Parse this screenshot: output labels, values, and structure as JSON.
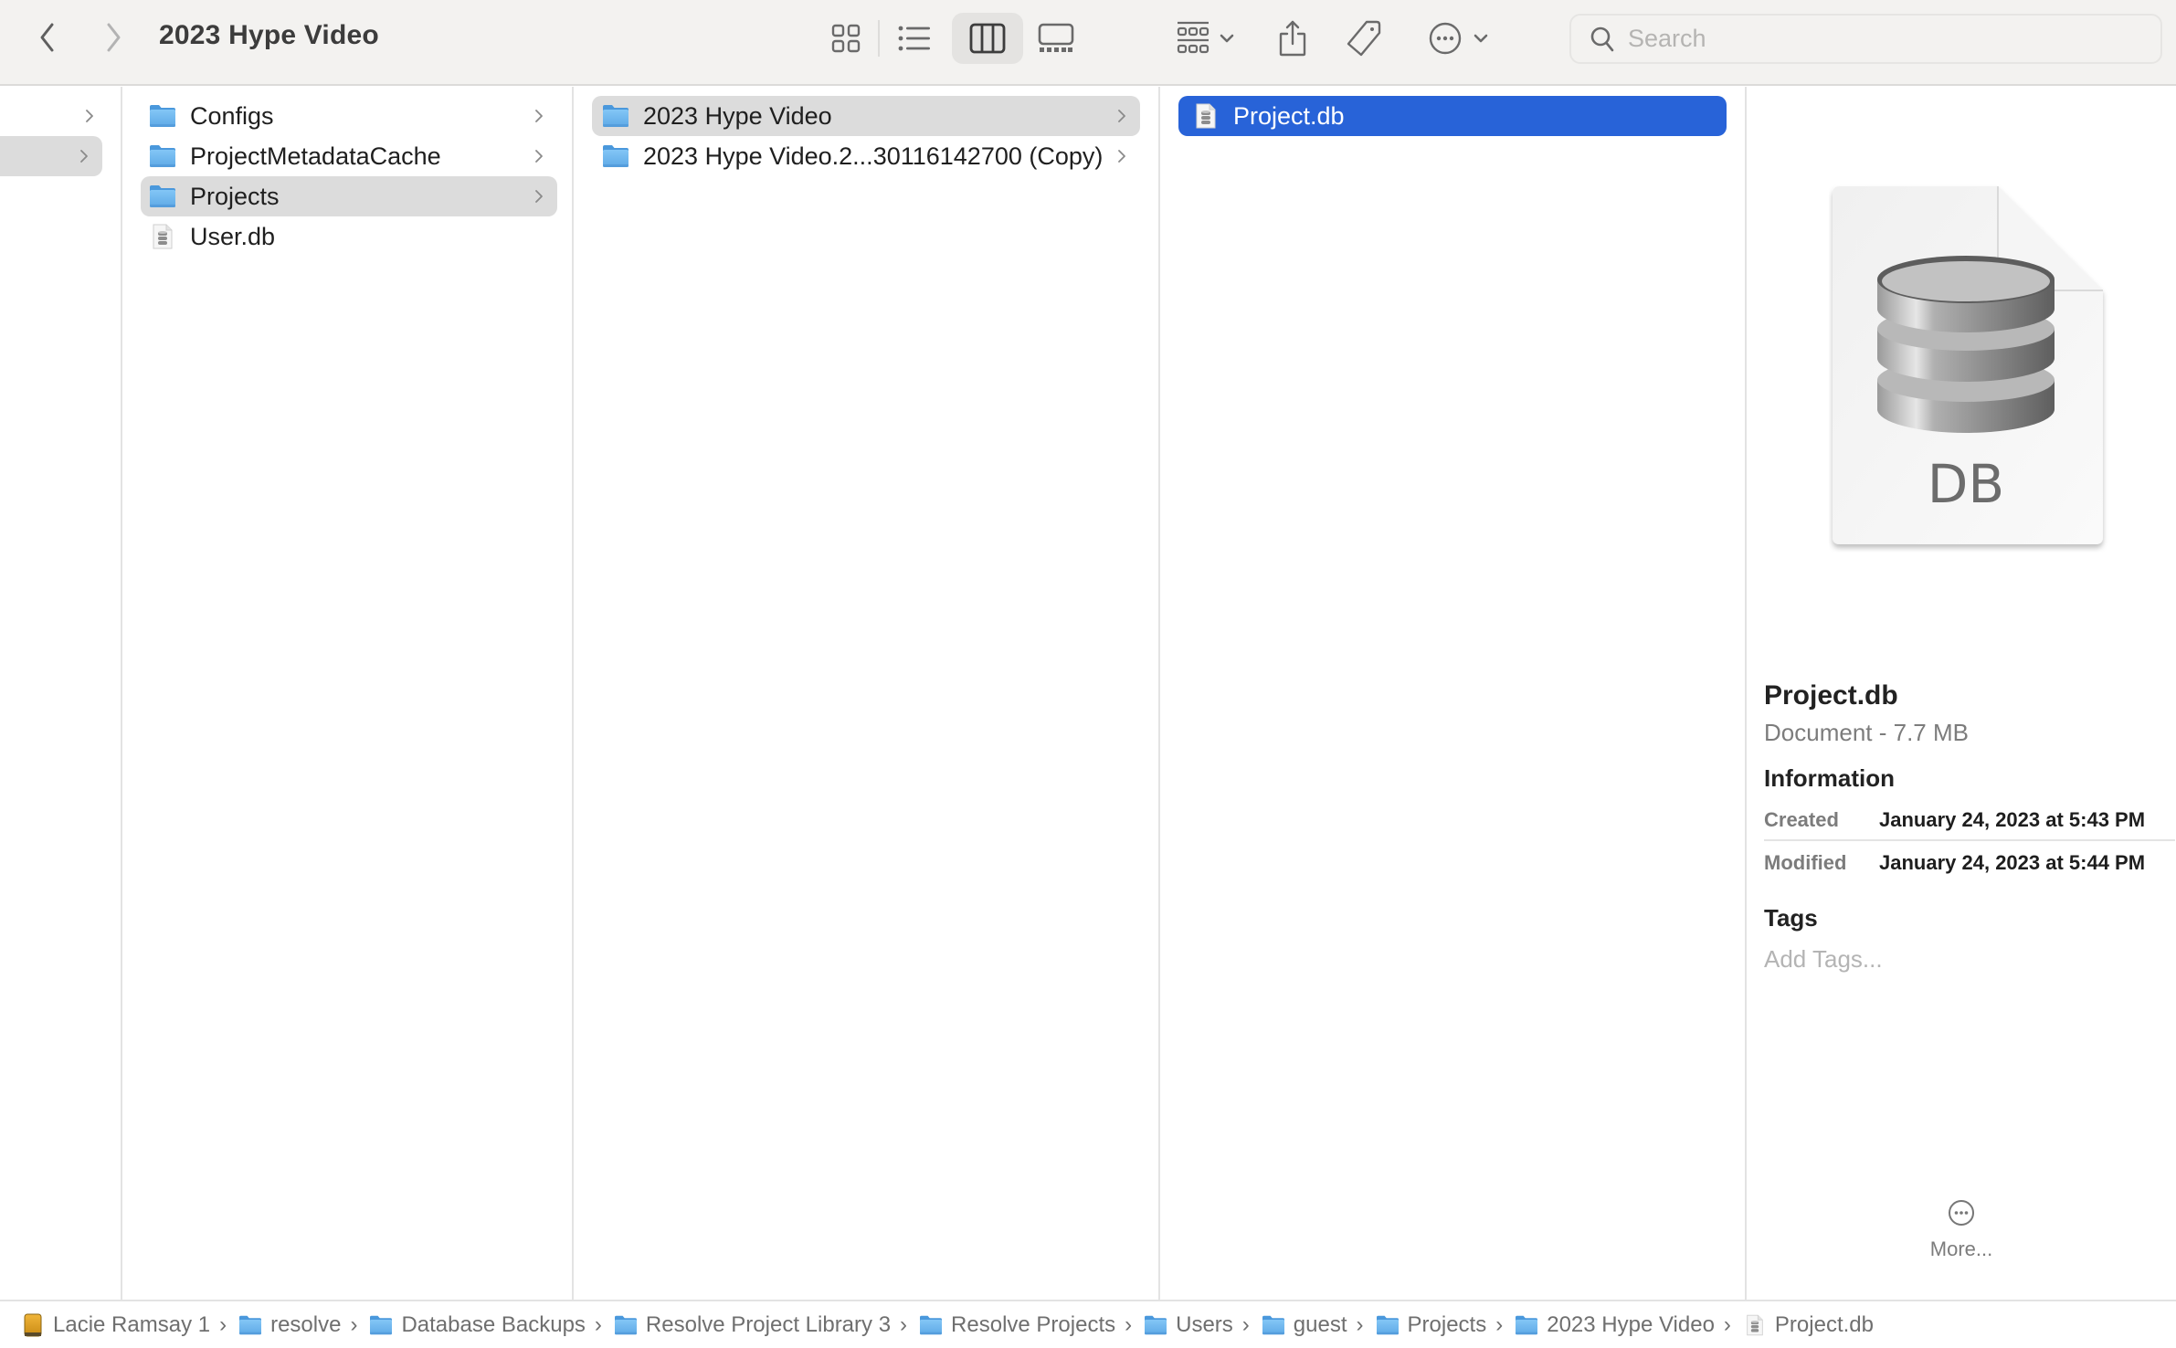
{
  "window": {
    "title": "2023 Hype Video"
  },
  "toolbar": {
    "back_icon": "chevron-left-icon",
    "forward_icon": "chevron-right-icon",
    "views": [
      {
        "name": "icon-view",
        "icon": "grid-icon",
        "active": false
      },
      {
        "name": "list-view",
        "icon": "list-icon",
        "active": false
      },
      {
        "name": "column-view",
        "icon": "columns-icon",
        "active": true
      },
      {
        "name": "gallery-view",
        "icon": "gallery-icon",
        "active": false
      }
    ],
    "group_icon": "group-icon",
    "share_icon": "share-icon",
    "tag_icon": "tag-icon",
    "action_icon": "ellipsis-circle-icon",
    "search": {
      "placeholder": "Search",
      "value": ""
    }
  },
  "columns": [
    {
      "items": [
        {
          "label": "",
          "type": "folder",
          "has_children": true,
          "selected": false
        },
        {
          "label": "",
          "type": "folder",
          "has_children": true,
          "selected": true
        }
      ]
    },
    {
      "items": [
        {
          "label": "Configs",
          "type": "folder",
          "has_children": true,
          "selected": false
        },
        {
          "label": "ProjectMetadataCache",
          "type": "folder",
          "has_children": true,
          "selected": false
        },
        {
          "label": "Projects",
          "type": "folder",
          "has_children": true,
          "selected": true
        },
        {
          "label": "User.db",
          "type": "db-file",
          "has_children": false,
          "selected": false
        }
      ]
    },
    {
      "items": [
        {
          "label": "2023 Hype Video",
          "type": "folder",
          "has_children": true,
          "selected": true
        },
        {
          "label": "2023 Hype Video.2...30116142700 (Copy)",
          "type": "folder",
          "has_children": true,
          "selected": false
        }
      ]
    },
    {
      "items": [
        {
          "label": "Project.db",
          "type": "db-file",
          "has_children": false,
          "selected": true
        }
      ]
    }
  ],
  "preview": {
    "icon_label": "DB",
    "name": "Project.db",
    "kind_size": "Document - 7.7 MB",
    "information_heading": "Information",
    "info": [
      {
        "key": "Created",
        "value": "January 24, 2023 at 5:43 PM"
      },
      {
        "key": "Modified",
        "value": "January 24, 2023 at 5:44 PM"
      }
    ],
    "tags_heading": "Tags",
    "add_tags_placeholder": "Add Tags...",
    "more_label": "More..."
  },
  "pathbar": [
    {
      "label": "Lacie Ramsay 1",
      "icon": "external-drive-icon"
    },
    {
      "label": "resolve",
      "icon": "folder-icon"
    },
    {
      "label": "Database Backups",
      "icon": "folder-icon"
    },
    {
      "label": "Resolve Project Library 3",
      "icon": "folder-icon"
    },
    {
      "label": "Resolve Projects",
      "icon": "folder-icon"
    },
    {
      "label": "Users",
      "icon": "folder-icon"
    },
    {
      "label": "guest",
      "icon": "folder-icon"
    },
    {
      "label": "Projects",
      "icon": "folder-icon"
    },
    {
      "label": "2023 Hype Video",
      "icon": "folder-icon"
    },
    {
      "label": "Project.db",
      "icon": "db-file-icon"
    }
  ],
  "colors": {
    "selection_blue": "#2863d8",
    "selection_gray": "#dcdcdc",
    "toolbar_bg": "#f3f2f0",
    "folder_blue": "#6cb6ee"
  }
}
